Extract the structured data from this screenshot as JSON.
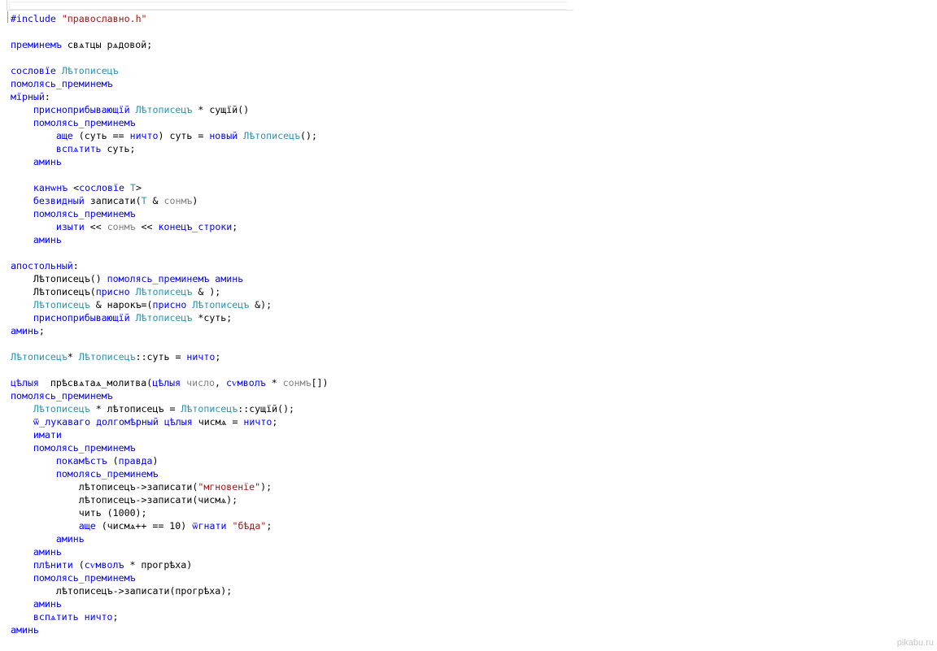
{
  "colors": {
    "keyword": "#0000ff",
    "type": "#2b91af",
    "string": "#a31515",
    "parameter": "#808080",
    "plain": "#000000",
    "preprocessor": "#808080"
  },
  "code_lines": [
    [
      {
        "t": "#include ",
        "c": "pp-kw"
      },
      {
        "t": "\"православно.h\"",
        "c": "str"
      }
    ],
    [],
    [
      {
        "t": "преминемъ ",
        "c": "kw"
      },
      {
        "t": "свѧтцы рѧдовой;",
        "c": "plain"
      }
    ],
    [],
    [
      {
        "t": "сословїе ",
        "c": "kw"
      },
      {
        "t": "Лѣтописецъ",
        "c": "type"
      }
    ],
    [
      {
        "t": "помолясь_преминемъ",
        "c": "kw"
      }
    ],
    [
      {
        "t": "мїрный",
        "c": "kw"
      },
      {
        "t": ":",
        "c": "plain"
      }
    ],
    [
      {
        "t": "    присноприбывающїй ",
        "c": "kw"
      },
      {
        "t": "Лѣтописецъ",
        "c": "type"
      },
      {
        "t": " * сущїй()",
        "c": "plain"
      }
    ],
    [
      {
        "t": "    помолясь_преминемъ",
        "c": "kw"
      }
    ],
    [
      {
        "t": "        аще ",
        "c": "kw"
      },
      {
        "t": "(суть == ",
        "c": "plain"
      },
      {
        "t": "ничто",
        "c": "kw"
      },
      {
        "t": ") суть = ",
        "c": "plain"
      },
      {
        "t": "новый ",
        "c": "kw"
      },
      {
        "t": "Лѣтописецъ",
        "c": "type"
      },
      {
        "t": "();",
        "c": "plain"
      }
    ],
    [
      {
        "t": "        вспѧтить ",
        "c": "kw"
      },
      {
        "t": "суть;",
        "c": "plain"
      }
    ],
    [
      {
        "t": "    аминь",
        "c": "kw"
      }
    ],
    [],
    [
      {
        "t": "    канѡнъ ",
        "c": "kw"
      },
      {
        "t": "<",
        "c": "plain"
      },
      {
        "t": "сословїе ",
        "c": "kw"
      },
      {
        "t": "T",
        "c": "type"
      },
      {
        "t": ">",
        "c": "plain"
      }
    ],
    [
      {
        "t": "    безвидный ",
        "c": "kw"
      },
      {
        "t": "записати(",
        "c": "plain"
      },
      {
        "t": "T",
        "c": "type"
      },
      {
        "t": " & ",
        "c": "plain"
      },
      {
        "t": "сонмъ",
        "c": "param"
      },
      {
        "t": ")",
        "c": "plain"
      }
    ],
    [
      {
        "t": "    помолясь_преминемъ",
        "c": "kw"
      }
    ],
    [
      {
        "t": "        изыти ",
        "c": "kw"
      },
      {
        "t": "<< ",
        "c": "plain"
      },
      {
        "t": "сонмъ",
        "c": "param"
      },
      {
        "t": " << ",
        "c": "plain"
      },
      {
        "t": "конецъ_строки",
        "c": "kw"
      },
      {
        "t": ";",
        "c": "plain"
      }
    ],
    [
      {
        "t": "    аминь",
        "c": "kw"
      }
    ],
    [],
    [
      {
        "t": "апостольный",
        "c": "kw"
      },
      {
        "t": ":",
        "c": "plain"
      }
    ],
    [
      {
        "t": "    Лѣтописецъ() ",
        "c": "plain"
      },
      {
        "t": "помолясь_преминемъ аминь",
        "c": "kw"
      }
    ],
    [
      {
        "t": "    Лѣтописецъ(",
        "c": "plain"
      },
      {
        "t": "присно ",
        "c": "kw"
      },
      {
        "t": "Лѣтописецъ",
        "c": "type"
      },
      {
        "t": " & );",
        "c": "plain"
      }
    ],
    [
      {
        "t": "    ",
        "c": "plain"
      },
      {
        "t": "Лѣтописецъ",
        "c": "type"
      },
      {
        "t": " & нарокъ=(",
        "c": "plain"
      },
      {
        "t": "присно ",
        "c": "kw"
      },
      {
        "t": "Лѣтописецъ",
        "c": "type"
      },
      {
        "t": " &);",
        "c": "plain"
      }
    ],
    [
      {
        "t": "    присноприбывающїй ",
        "c": "kw"
      },
      {
        "t": "Лѣтописецъ",
        "c": "type"
      },
      {
        "t": " *суть;",
        "c": "plain"
      }
    ],
    [
      {
        "t": "аминь",
        "c": "kw"
      },
      {
        "t": ";",
        "c": "plain"
      }
    ],
    [],
    [
      {
        "t": "Лѣтописецъ",
        "c": "type"
      },
      {
        "t": "* ",
        "c": "plain"
      },
      {
        "t": "Лѣтописецъ",
        "c": "type"
      },
      {
        "t": "::суть = ",
        "c": "plain"
      },
      {
        "t": "ничто",
        "c": "kw"
      },
      {
        "t": ";",
        "c": "plain"
      }
    ],
    [],
    [
      {
        "t": "цѣлыя ",
        "c": "kw"
      },
      {
        "t": " прѣсвѧтаѧ_молитва(",
        "c": "plain"
      },
      {
        "t": "цѣлыя ",
        "c": "kw"
      },
      {
        "t": "число",
        "c": "param"
      },
      {
        "t": ", ",
        "c": "plain"
      },
      {
        "t": "сѵмволъ",
        "c": "kw"
      },
      {
        "t": " * ",
        "c": "plain"
      },
      {
        "t": "сонмъ",
        "c": "param"
      },
      {
        "t": "[])",
        "c": "plain"
      }
    ],
    [
      {
        "t": "помолясь_преминемъ",
        "c": "kw"
      }
    ],
    [
      {
        "t": "    ",
        "c": "plain"
      },
      {
        "t": "Лѣтописецъ",
        "c": "type"
      },
      {
        "t": " * лѣтописецъ = ",
        "c": "plain"
      },
      {
        "t": "Лѣтописецъ",
        "c": "type"
      },
      {
        "t": "::сущїй();",
        "c": "plain"
      }
    ],
    [
      {
        "t": "    ѿ_лукаваго долгомѣрный цѣлыя ",
        "c": "kw"
      },
      {
        "t": "чисмѧ = ",
        "c": "plain"
      },
      {
        "t": "ничто",
        "c": "kw"
      },
      {
        "t": ";",
        "c": "plain"
      }
    ],
    [
      {
        "t": "    имати",
        "c": "kw"
      }
    ],
    [
      {
        "t": "    помолясь_преминемъ",
        "c": "kw"
      }
    ],
    [
      {
        "t": "        покамѣстъ ",
        "c": "kw"
      },
      {
        "t": "(",
        "c": "plain"
      },
      {
        "t": "правда",
        "c": "kw"
      },
      {
        "t": ")",
        "c": "plain"
      }
    ],
    [
      {
        "t": "        помолясь_преминемъ",
        "c": "kw"
      }
    ],
    [
      {
        "t": "            лѣтописецъ->записати(",
        "c": "plain"
      },
      {
        "t": "\"мгновенїе\"",
        "c": "str"
      },
      {
        "t": ");",
        "c": "plain"
      }
    ],
    [
      {
        "t": "            лѣтописецъ->записати(чисмѧ);",
        "c": "plain"
      }
    ],
    [
      {
        "t": "            чить (1000);",
        "c": "plain"
      }
    ],
    [
      {
        "t": "            аще ",
        "c": "kw"
      },
      {
        "t": "(чисмѧ++ == 10) ",
        "c": "plain"
      },
      {
        "t": "ѿгнати ",
        "c": "kw"
      },
      {
        "t": "\"бѣда\"",
        "c": "str"
      },
      {
        "t": ";",
        "c": "plain"
      }
    ],
    [
      {
        "t": "        аминь",
        "c": "kw"
      }
    ],
    [
      {
        "t": "    аминь",
        "c": "kw"
      }
    ],
    [
      {
        "t": "    плѣнити ",
        "c": "kw"
      },
      {
        "t": "(",
        "c": "plain"
      },
      {
        "t": "сѵмволъ",
        "c": "kw"
      },
      {
        "t": " * прогрѣха)",
        "c": "plain"
      }
    ],
    [
      {
        "t": "    помолясь_преминемъ",
        "c": "kw"
      }
    ],
    [
      {
        "t": "        лѣтописецъ->записати(прогрѣха);",
        "c": "plain"
      }
    ],
    [
      {
        "t": "    аминь",
        "c": "kw"
      }
    ],
    [
      {
        "t": "    вспѧтить ",
        "c": "kw"
      },
      {
        "t": "ничто",
        "c": "kw"
      },
      {
        "t": ";",
        "c": "plain"
      }
    ],
    [
      {
        "t": "аминь",
        "c": "kw"
      }
    ]
  ],
  "watermark": "pikabu.ru"
}
